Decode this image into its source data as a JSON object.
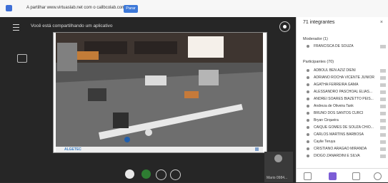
{
  "topbar": {
    "message": "A partilhar www.virtuaslab.net com o callbcolab.com...",
    "button": "Parar"
  },
  "share": {
    "title": "Você está compartilhando um aplicativo"
  },
  "frame": {
    "brand": "ALGETEC"
  },
  "bottom": {
    "presenter": "Mario 0984..."
  },
  "panel": {
    "count": "71 integrantes",
    "close": "×",
    "moderator_header": "Moderador (1)",
    "moderator": "FRANCISCA DE SOUZA",
    "participants_header": "Participantes (70)",
    "participants": [
      "ADBOUL BEN AZIZ DIENI",
      "ADRIANO ROCHA VICENTE JUNIOR",
      "AGATHA FERREIRA GAMA",
      "ALESSANDRO PASCHOAL ELIAS...",
      "ANDREI SOARES BIAZETTO PEIS...",
      "Andreza de Oliveira Tank",
      "BRUNO DOS SANTOS CURCI",
      "Bryan Cirqueira",
      "CAIQUE GOMES DE SOUZA CHIO...",
      "CARLOS MARTINS BARBOSA",
      "Caylie Teruya",
      "CRISTIANO ARAGAO MIRANDA",
      "DIOGO ZANARDINI E SILVA"
    ]
  }
}
